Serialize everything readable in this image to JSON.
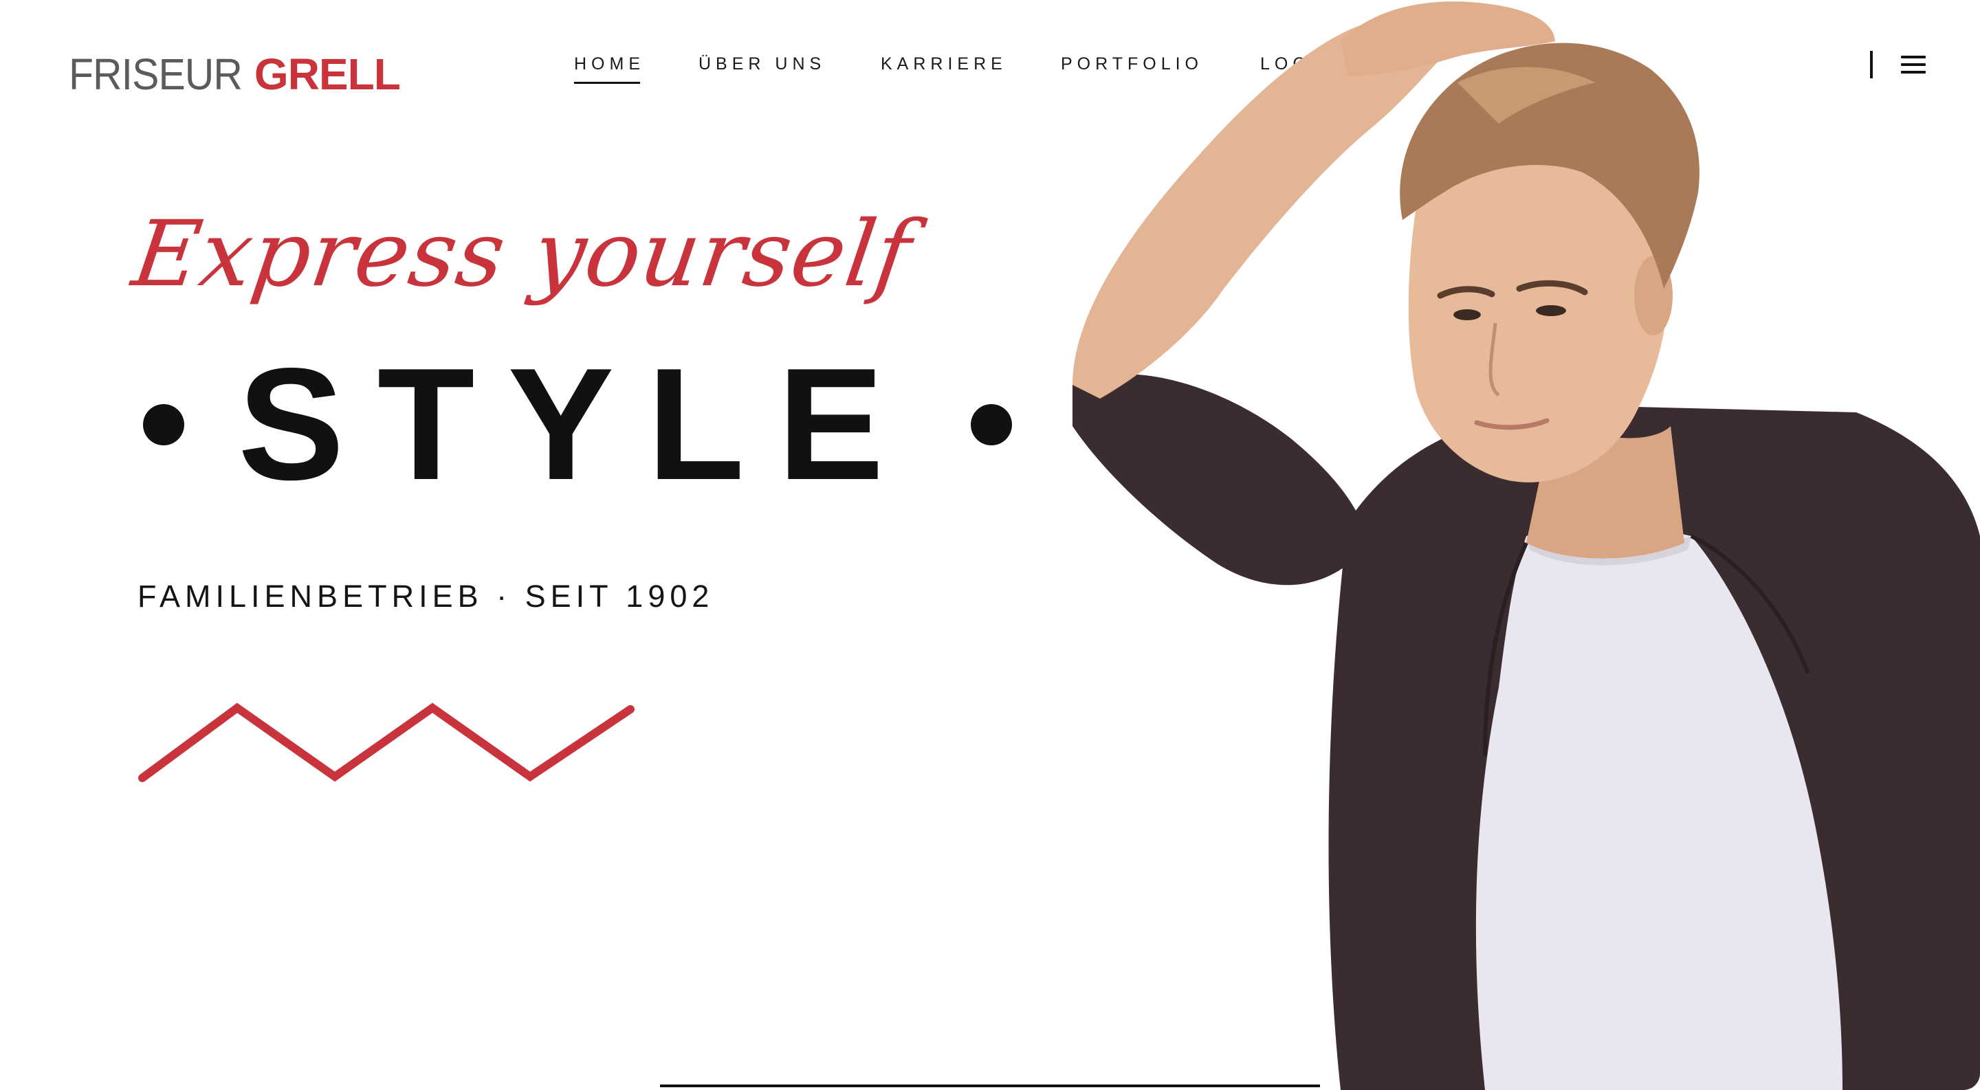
{
  "header": {
    "logo_light": "FRISEUR",
    "logo_bold": "GRELL",
    "nav": [
      "HOME",
      "ÜBER UNS",
      "KARRIERE",
      "PORTFOLIO",
      "LOCATIONS"
    ],
    "active_nav": "HOME",
    "menu_icon": "hamburger-menu-icon"
  },
  "hero": {
    "tagline": "Express yourself",
    "headline": "STYLE",
    "subline": "FAMILIENBETRIEB · SEIT 1902",
    "image": "man-with-hand-in-hair-photo"
  },
  "colors": {
    "accent": "#c9343c",
    "text": "#111111",
    "background": "#ffffff",
    "jacket": "#3a2c2f",
    "shirt": "#e8e6ee",
    "hair": "#a87a58",
    "skin": "#e3b594"
  }
}
